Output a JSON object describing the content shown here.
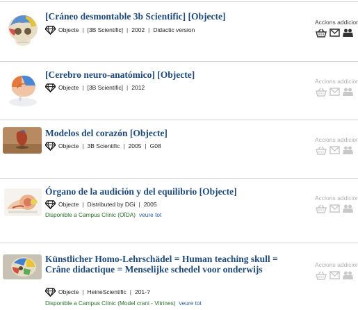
{
  "actions_label": "Accions addicionals",
  "type_label": "Objecte",
  "available_more_label": "veure tot",
  "colors": {
    "title": "#1f4a7a",
    "available": "#2a6e2a",
    "link": "#2a5d9a",
    "icon_active": "#333333",
    "icon_dim": "#c8c8c8"
  },
  "icons": [
    "gem-icon",
    "basket-icon",
    "mail-icon",
    "people-icon"
  ],
  "results": [
    {
      "title": "[Cráneo desmontable 3b Scientific] [Objecte]",
      "meta": [
        "[3B Scientific]",
        "2002",
        "Didactic version"
      ],
      "availability": "",
      "active": true
    },
    {
      "title": "[Cerebro neuro-anatómico] [Objecte]",
      "meta": [
        "[3B Scientific]",
        "2012"
      ],
      "availability": "",
      "active": false
    },
    {
      "title": "Modelos del corazón [Objecte]",
      "meta": [
        "3B Scientific",
        "2005",
        "G08"
      ],
      "availability": "",
      "active": false
    },
    {
      "title": "Órgano de la audición y del equilibrio [Objecte]",
      "meta": [
        "Distributed by DGi",
        "2005"
      ],
      "availability": "Disponible a Campus Clínic (OÏDA)",
      "active": false
    },
    {
      "title": "Künstlicher Homo-Lehrschädel = Human teaching skull = Crâne didactique = Menselijke schedel voor onderwijs",
      "meta": [
        "HeineScientific",
        "201-?"
      ],
      "availability": "Disponible a Campus Clínic (Model crani - Vitrines)",
      "active": false
    }
  ]
}
